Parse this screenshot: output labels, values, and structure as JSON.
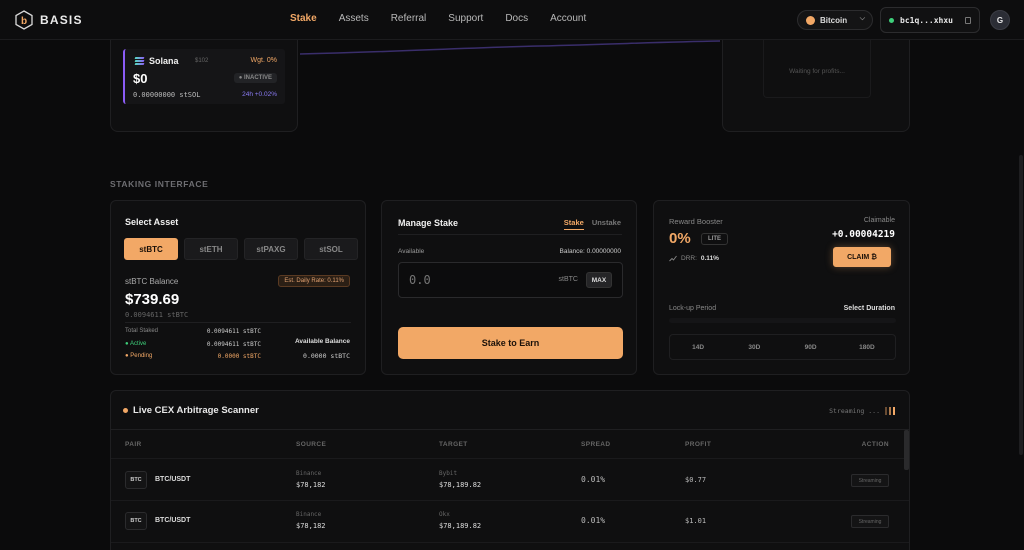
{
  "nav": {
    "brand": "BASIS",
    "links": [
      "Stake",
      "Assets",
      "Referral",
      "Support",
      "Docs",
      "Account"
    ],
    "active_link": "Stake",
    "chain": "Bitcoin",
    "wallet": "bc1q...xhxu",
    "avatar": "G"
  },
  "top_card": {
    "name": "Solana",
    "ticker": "$102",
    "weight": "Wgt. 0%",
    "value": "$0",
    "status": "● INACTIVE",
    "amount": "0.00000000 stSOL",
    "change": "24h +0.02%",
    "colors": {
      "accent": "#8b5cf6"
    }
  },
  "profits_panel": {
    "waiting_text": "Waiting for profits..."
  },
  "section_title": "STAKING INTERFACE",
  "select_asset": {
    "title": "Select Asset",
    "tabs": [
      "stBTC",
      "stETH",
      "stPAXG",
      "stSOL"
    ],
    "active_tab": "stBTC",
    "balance_label": "stBTC Balance",
    "rate": "Est. Daily Rate: 0.11%",
    "balance_usd": "$739.69",
    "balance_token": "0.0094611 stBTC",
    "stats": [
      {
        "key": "Total Staked",
        "value": "0.0094611 stBTC"
      },
      {
        "key": "● Active",
        "value": "0.0094611 stBTC"
      },
      {
        "key": "● Pending",
        "value": "0.0000 stBTC"
      }
    ],
    "available_label": "Available Balance",
    "available_value": "0.0000 stBTC"
  },
  "manage": {
    "title": "Manage Stake",
    "mode_stake": "Stake",
    "mode_unstake": "Unstake",
    "available_label": "Available",
    "balance": "Balance: 0.00000000",
    "placeholder": "0.0",
    "unit": "stBTC",
    "max_label": "MAX",
    "stake_button": "Stake to Earn"
  },
  "booster": {
    "label": "Reward Booster",
    "claimable_label": "Claimable",
    "percent": "0%",
    "tier": "LITE",
    "claim_amount": "+0.00004219",
    "drr_label": "DRR:",
    "drr_value": "0.11%",
    "claim_button": "CLAIM ₿",
    "lock_label": "Lock-up Period",
    "duration_label": "Select Duration",
    "durations": [
      "14D",
      "30D",
      "90D",
      "180D"
    ]
  },
  "scanner": {
    "title": "Live CEX Arbitrage Scanner",
    "status": "Streaming ...",
    "headers": [
      "PAIR",
      "SOURCE",
      "TARGET",
      "SPREAD",
      "PROFIT",
      "ACTION"
    ],
    "rows": [
      {
        "badge": "BTC",
        "pair": "BTC/USDT",
        "source_ex": "Binance",
        "source_price": "$78,182",
        "target_ex": "Bybit",
        "target_price": "$78,189.82",
        "spread": "0.01%",
        "profit": "$0.77",
        "action": "Streaming"
      },
      {
        "badge": "BTC",
        "pair": "BTC/USDT",
        "source_ex": "Binance",
        "source_price": "$78,182",
        "target_ex": "Okx",
        "target_price": "$78,189.82",
        "spread": "0.01%",
        "profit": "$1.01",
        "action": "Streaming"
      }
    ]
  },
  "colors": {
    "accent": "#f2a866",
    "background": "#0b0b0c",
    "panel": "#0f0f10",
    "success": "#3ecf7a"
  }
}
